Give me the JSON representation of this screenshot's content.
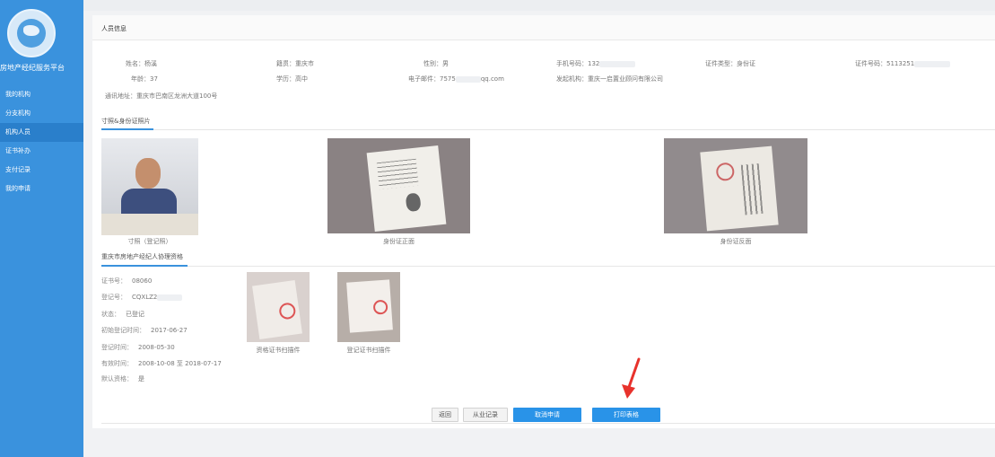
{
  "sidebar": {
    "platform_name": "房地产经纪服务平台",
    "logo_icon": "association-globe-logo",
    "items": [
      {
        "label": "我的机构"
      },
      {
        "label": "分支机构"
      },
      {
        "label": "机构人员",
        "active": true
      },
      {
        "label": "证书补办"
      },
      {
        "label": "支付记录"
      },
      {
        "label": "我的申请"
      }
    ]
  },
  "panel": {
    "title": "人员信息"
  },
  "person": {
    "name": "姓名：杨溪",
    "native": "籍贯：重庆市",
    "gender": "性别：男",
    "phone": "手机号码：132",
    "id_type": "证件类型：身份证",
    "id_no": "证件号码：5113251",
    "age": "年龄：37",
    "education": "学历：高中",
    "email_prefix": "电子邮件：7575",
    "email_suffix": "qq.com",
    "org": "发起机构：重庆一启置业顾问有限公司",
    "address": "通讯地址：重庆市巴南区龙洲大道100号"
  },
  "photos_section": {
    "title": "寸照&身份证照片",
    "captions": {
      "portrait": "寸照（登记照）",
      "id_front": "身份证正面",
      "id_back": "身份证反面"
    }
  },
  "qualification": {
    "title": "重庆市房地产经纪人协理资格",
    "fields": [
      {
        "label": "证书号：",
        "value": "08060"
      },
      {
        "label": "登记号：",
        "value": "CQXLZ2"
      },
      {
        "label": "状态：",
        "value": "已登记"
      },
      {
        "label": "初始登记时间：",
        "value": "2017-06-27"
      },
      {
        "label": "登记时间：",
        "value": "2008-05-30"
      },
      {
        "label": "有效时间：",
        "value": "2008-10-08 至 2018-07-17"
      },
      {
        "label": "默认资格：",
        "value": "是"
      }
    ],
    "scan_captions": {
      "cert": "资格证书扫描件",
      "reg": "登记证书扫描件"
    }
  },
  "buttons": {
    "back": "返回",
    "history": "从业记录",
    "cancel": "取消申请",
    "print": "打印表格"
  },
  "colors": {
    "sidebar": "#3a92dd",
    "primary": "#2993e8",
    "arrow": "#e8322c"
  }
}
